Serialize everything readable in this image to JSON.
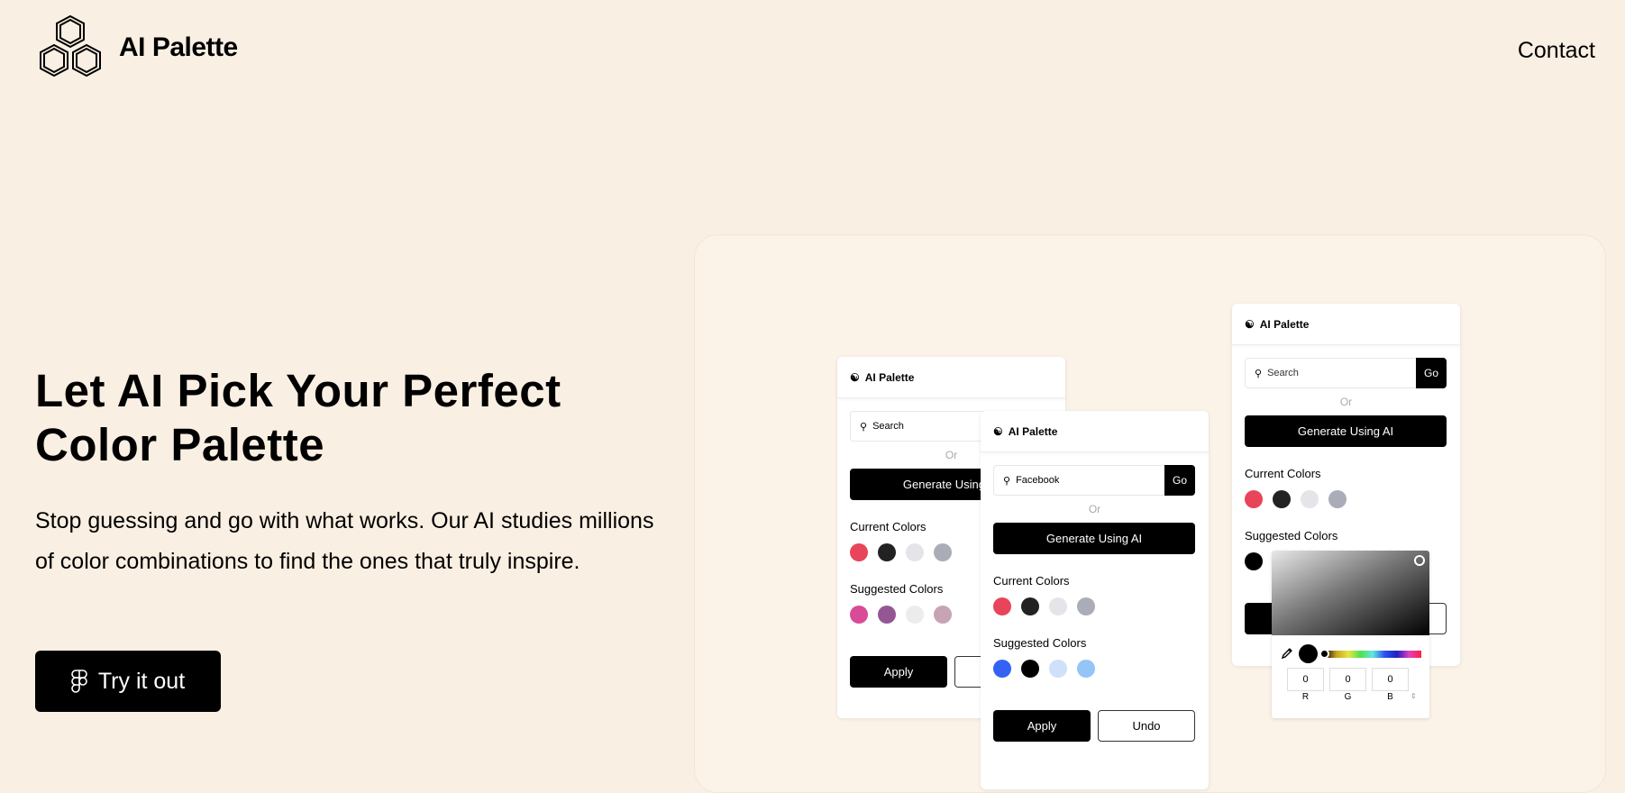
{
  "header": {
    "brand": "AI Palette",
    "contact": "Contact"
  },
  "hero": {
    "headline_line1": "Let AI Pick Your Perfect",
    "headline_line2": "Color Palette",
    "description": "Stop guessing and go with what works. Our AI studies millions of color combinations to find the ones that truly inspire.",
    "cta": "Try it out"
  },
  "plugin": {
    "title": "AI Palette",
    "or": "Or",
    "generate": "Generate Using AI",
    "go": "Go",
    "current_label": "Current Colors",
    "suggested_label": "Suggested Colors",
    "apply": "Apply",
    "undo": "Undo",
    "current_colors": [
      "#e8445a",
      "#222222",
      "#e5e4e9",
      "#aaadb8"
    ],
    "cards": [
      {
        "search": "Search",
        "suggested_colors": [
          "#d94a97",
          "#955794",
          "#ececec",
          "#c6a4b3"
        ]
      },
      {
        "search": "Facebook",
        "suggested_colors": [
          "#3462f5",
          "#000000",
          "#cfe0fb",
          "#95c4f7"
        ]
      },
      {
        "search": "Search",
        "suggested_colors": [
          "#000000"
        ]
      }
    ]
  },
  "picker": {
    "r": "0",
    "g": "0",
    "b": "0",
    "r_label": "R",
    "g_label": "G",
    "b_label": "B",
    "selected": "#000000"
  }
}
